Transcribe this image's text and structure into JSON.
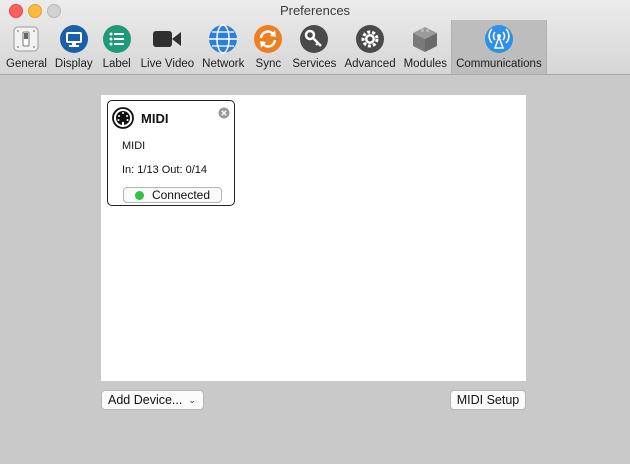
{
  "window": {
    "title": "Preferences"
  },
  "toolbar": {
    "items": [
      {
        "label": "General",
        "icon": "switch-icon"
      },
      {
        "label": "Display",
        "icon": "monitor-icon"
      },
      {
        "label": "Label",
        "icon": "list-icon"
      },
      {
        "label": "Live Video",
        "icon": "video-camera-icon"
      },
      {
        "label": "Network",
        "icon": "globe-icon"
      },
      {
        "label": "Sync",
        "icon": "sync-icon"
      },
      {
        "label": "Services",
        "icon": "key-icon"
      },
      {
        "label": "Advanced",
        "icon": "gear-icon"
      },
      {
        "label": "Modules",
        "icon": "cube-icon"
      },
      {
        "label": "Communications",
        "icon": "antenna-icon",
        "selected": true
      }
    ]
  },
  "devices": [
    {
      "title": "MIDI",
      "subtitle": "MIDI",
      "stats": "In: 1/13 Out: 0/14",
      "status": "Connected",
      "status_color": "#2fc140"
    }
  ],
  "buttons": {
    "add_device": "Add Device...",
    "midi_setup": "MIDI Setup"
  }
}
